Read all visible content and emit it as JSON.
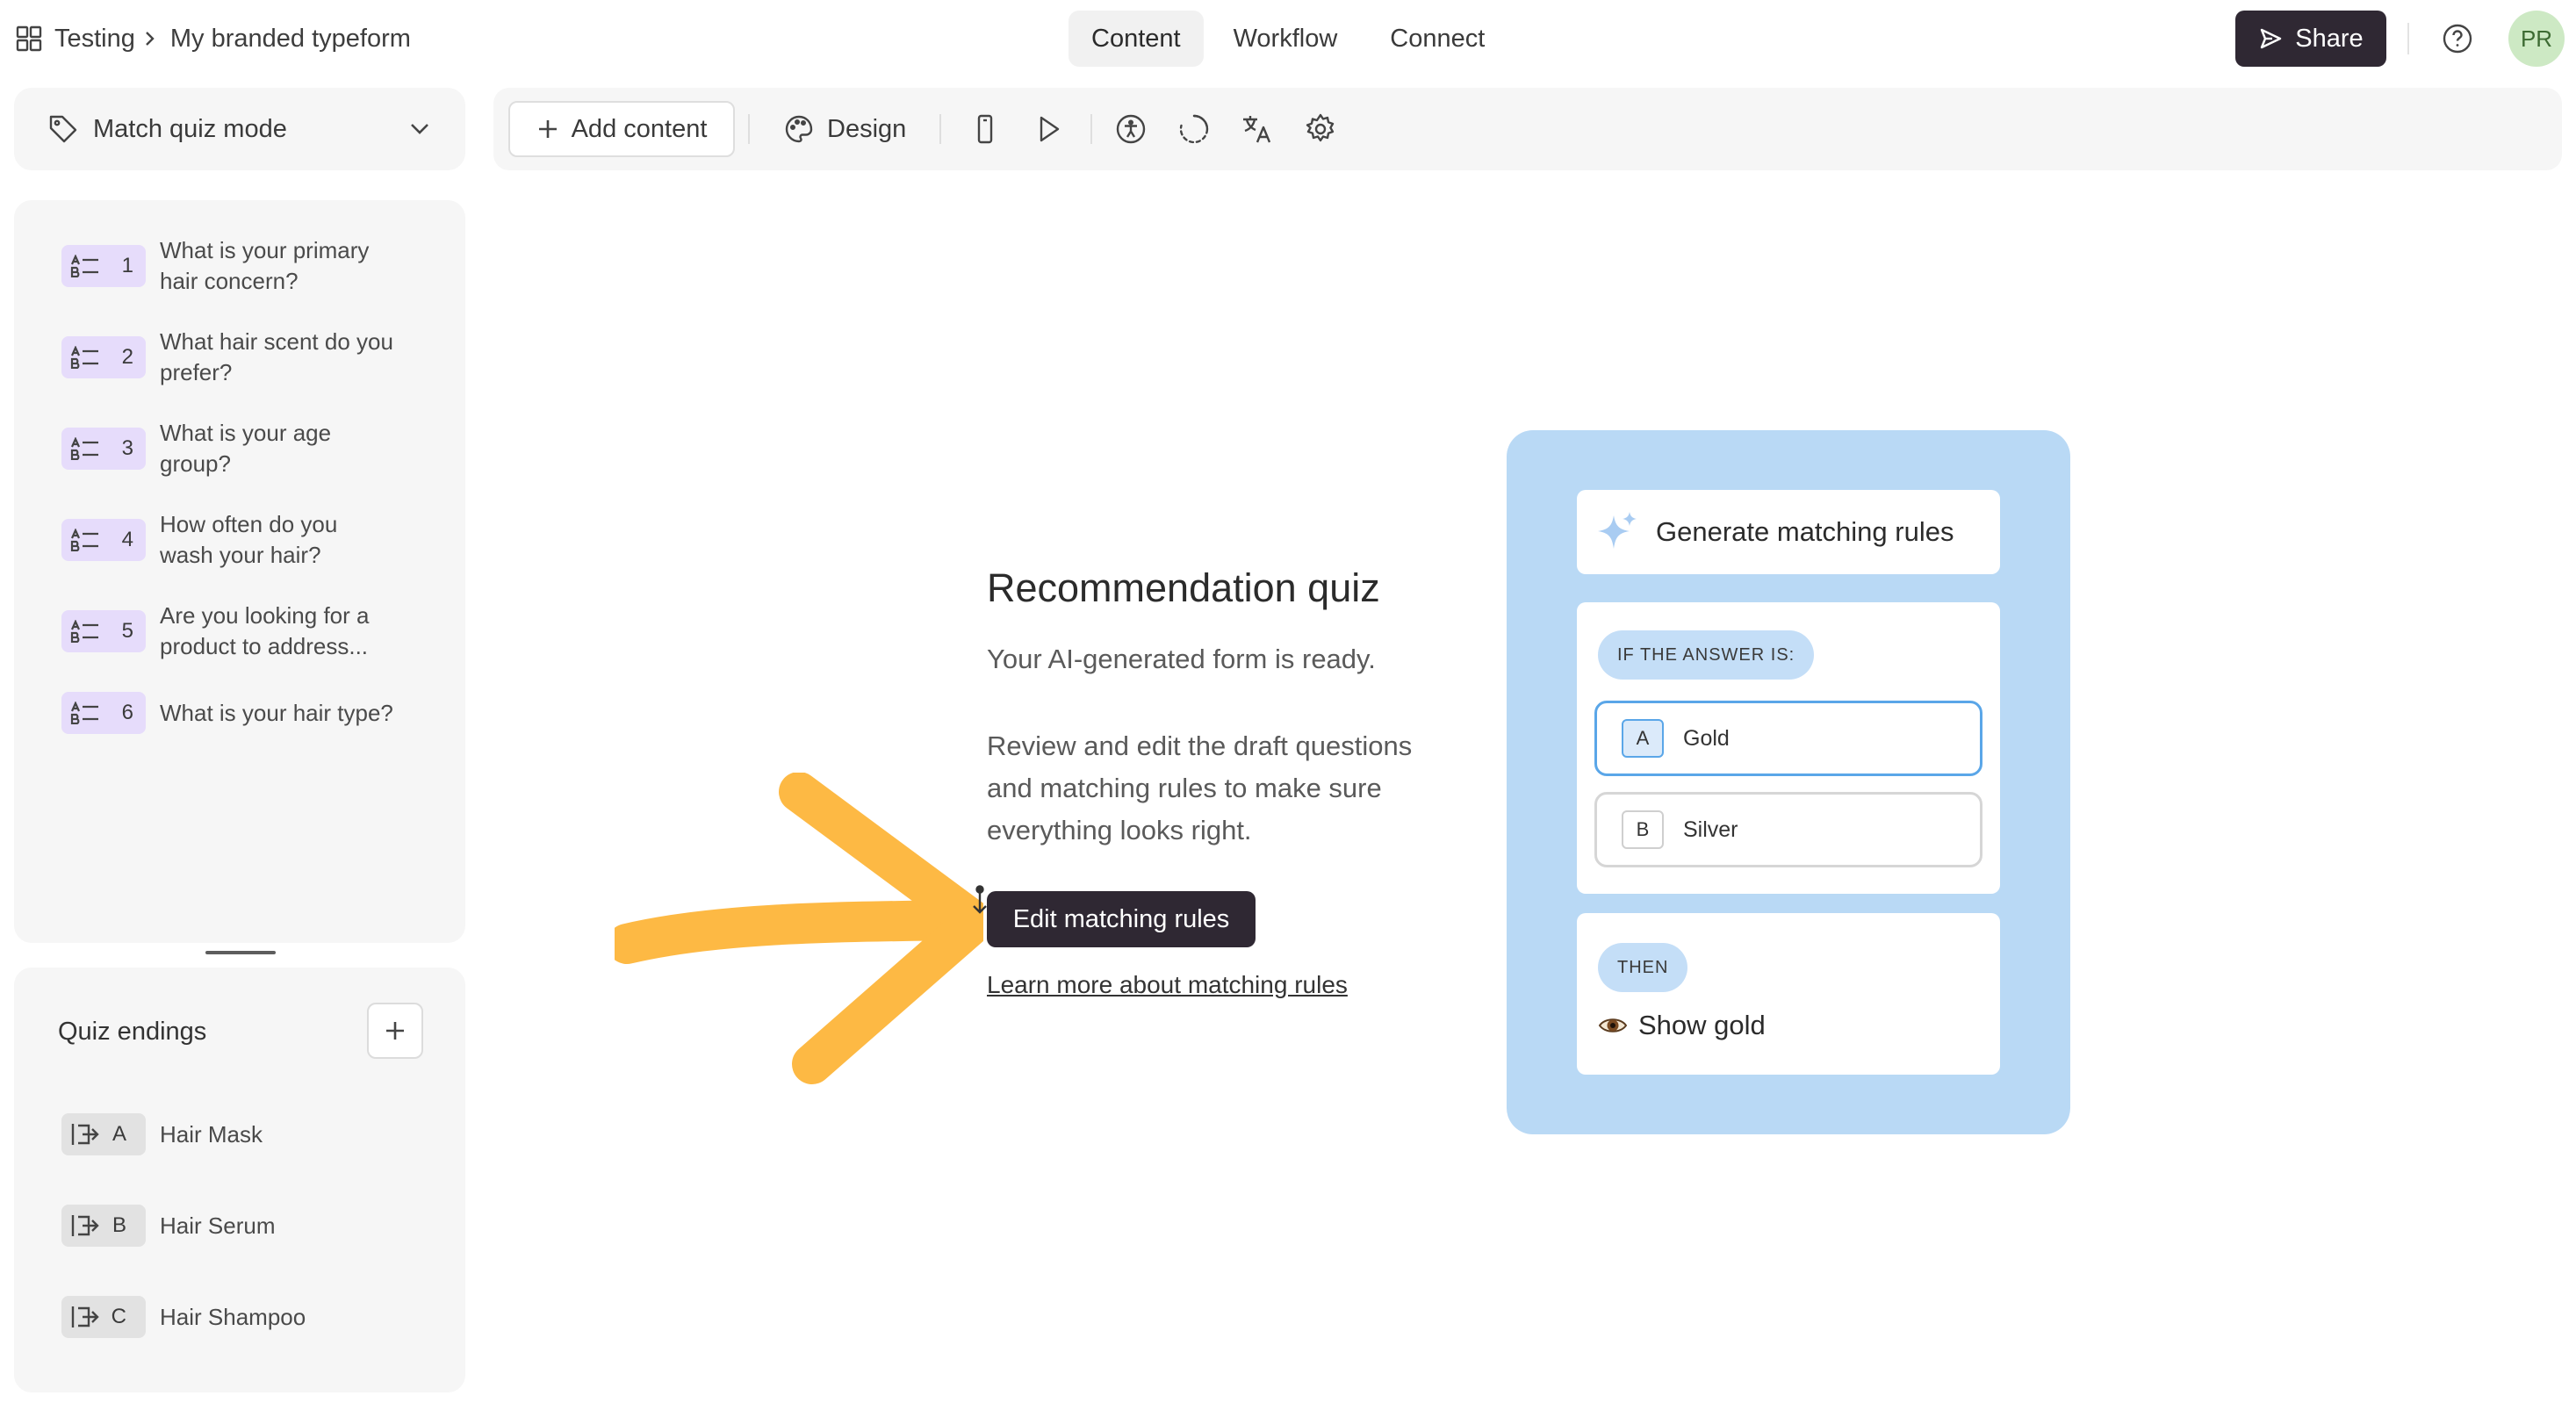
{
  "breadcrumb": {
    "workspace": "Testing",
    "form": "My branded typeform"
  },
  "nav": {
    "tabs": [
      "Content",
      "Workflow",
      "Connect"
    ],
    "active": 0
  },
  "header": {
    "share_label": "Share",
    "avatar_initials": "PR"
  },
  "sidebar": {
    "mode_label": "Match quiz mode",
    "questions": [
      {
        "num": "1",
        "text": "What is your primary hair concern?"
      },
      {
        "num": "2",
        "text": "What hair scent do you prefer?"
      },
      {
        "num": "3",
        "text": "What is your age group?"
      },
      {
        "num": "4",
        "text": "How often do you wash your hair?"
      },
      {
        "num": "5",
        "text": "Are you looking for a product to address..."
      },
      {
        "num": "6",
        "text": "What is your hair type?"
      }
    ],
    "endings_title": "Quiz endings",
    "endings": [
      {
        "key": "A",
        "text": "Hair Mask"
      },
      {
        "key": "B",
        "text": "Hair Serum"
      },
      {
        "key": "C",
        "text": "Hair Shampoo"
      }
    ]
  },
  "toolbar": {
    "add_content_label": "Add content",
    "design_label": "Design"
  },
  "main": {
    "title": "Recommendation quiz",
    "subtitle": "Your AI-generated form is ready.",
    "description": "Review and edit the draft questions and matching rules to make sure everything looks right.",
    "edit_button": "Edit matching rules",
    "learn_link": "Learn more about matching rules"
  },
  "illustration": {
    "generate_label": "Generate matching rules",
    "if_label": "IF THE ANSWER IS:",
    "options": [
      {
        "key": "A",
        "text": "Gold"
      },
      {
        "key": "B",
        "text": "Silver"
      }
    ],
    "then_label": "THEN",
    "then_action": "Show gold"
  },
  "colors": {
    "dark_button": "#2f2833",
    "accent_arrow": "#fdb944",
    "illustration_bg": "#b9d9f5",
    "question_badge": "#e6dcfb",
    "avatar_bg": "#cde9c4"
  },
  "icons": [
    "grid-icon",
    "chevron-right-icon",
    "share-arrow-icon",
    "help-icon",
    "tag-icon",
    "chevron-down-icon",
    "multiple-choice-icon",
    "exit-icon",
    "plus-icon",
    "palette-icon",
    "mobile-icon",
    "play-icon",
    "accessibility-icon",
    "loading-icon",
    "translate-icon",
    "gear-icon",
    "sparkle-icon",
    "eye-icon"
  ]
}
